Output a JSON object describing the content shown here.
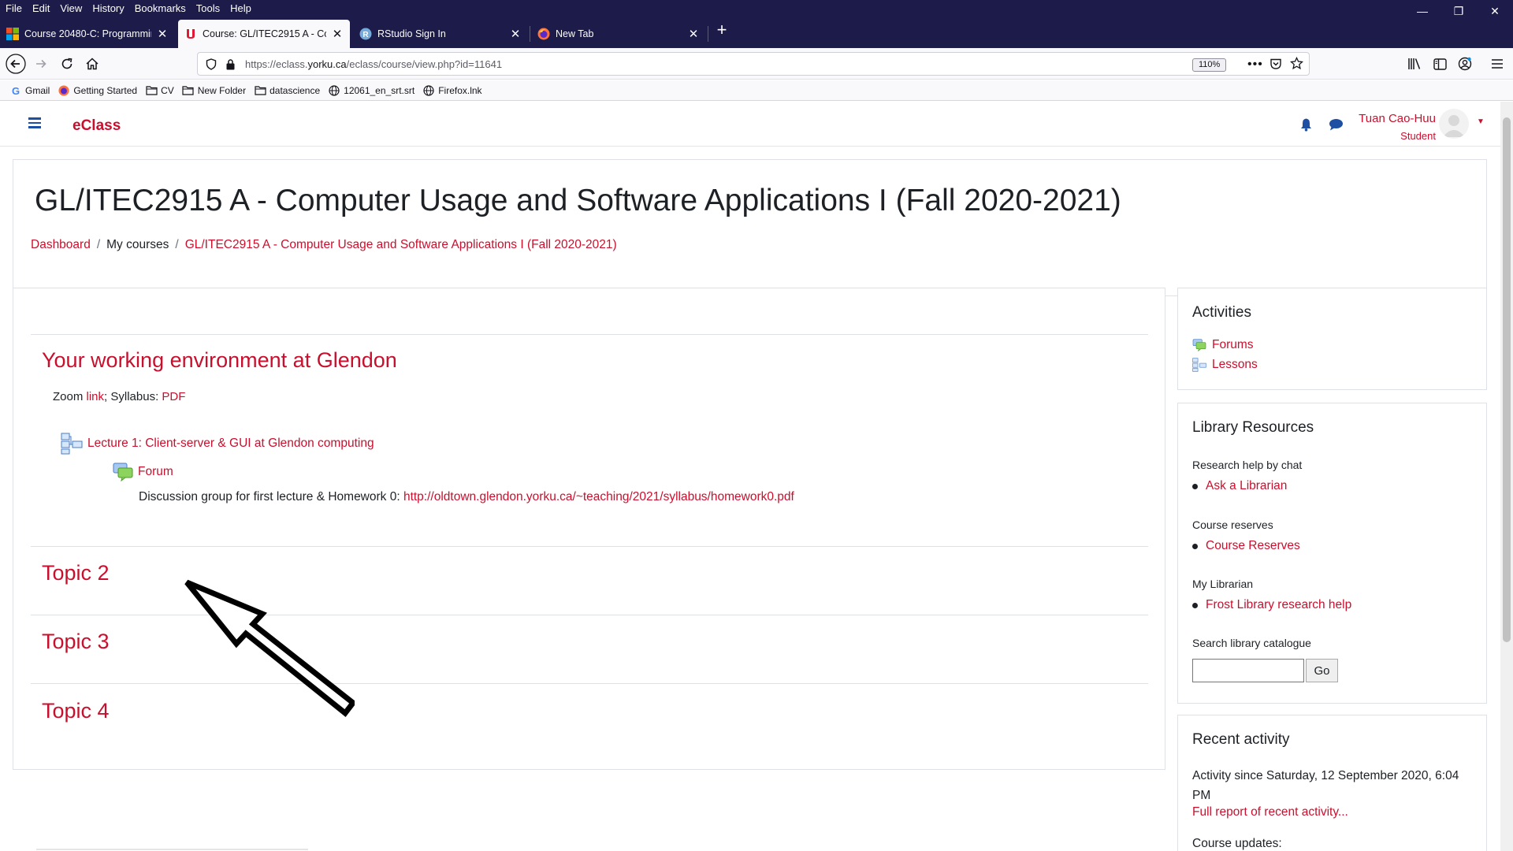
{
  "browser": {
    "menu": [
      "File",
      "Edit",
      "View",
      "History",
      "Bookmarks",
      "Tools",
      "Help"
    ],
    "tabs": [
      {
        "title": "Course 20480-C: Programming",
        "favicon": "microsoft-icon",
        "active": false
      },
      {
        "title": "Course: GL/ITEC2915 A - Comp",
        "favicon": "york-u-icon",
        "active": true
      },
      {
        "title": "RStudio Sign In",
        "favicon": "rstudio-icon",
        "active": false
      },
      {
        "title": "New Tab",
        "favicon": "firefox-icon",
        "active": false
      }
    ],
    "url_prefix": "https://eclass.",
    "url_domain": "yorku.ca",
    "url_suffix": "/eclass/course/view.php?id=11641",
    "zoom": "110%",
    "bookmarks": [
      {
        "label": "Gmail",
        "icon": "google-icon"
      },
      {
        "label": "Getting Started",
        "icon": "firefox-icon"
      },
      {
        "label": "CV",
        "icon": "folder-icon"
      },
      {
        "label": "New Folder",
        "icon": "folder-icon"
      },
      {
        "label": "datascience",
        "icon": "folder-icon"
      },
      {
        "label": "12061_en_srt.srt",
        "icon": "globe-icon"
      },
      {
        "label": "Firefox.lnk",
        "icon": "globe-icon"
      }
    ]
  },
  "site": {
    "brand": "eClass",
    "user_name": "Tuan Cao-Huu",
    "user_role": "Student"
  },
  "course": {
    "title": "GL/ITEC2915 A - Computer Usage and Software Applications I (Fall 2020-2021)",
    "breadcrumb": [
      {
        "label": "Dashboard",
        "link": true
      },
      {
        "label": "My courses",
        "link": false
      },
      {
        "label": "GL/ITEC2915 A - Computer Usage and Software Applications I (Fall 2020-2021)",
        "link": true
      }
    ],
    "section1_title": "Your working environment at Glendon",
    "summary_prefix": "Zoom ",
    "summary_zoom_link": "link",
    "summary_mid": "; Syllabus: ",
    "summary_pdf_link": "PDF",
    "lesson_label": "Lecture 1: Client-server & GUI at Glendon computing",
    "forum_label": "Forum",
    "forum_desc": "Discussion group for first lecture & Homework 0: ",
    "forum_desc_link": "http://oldtown.glendon.yorku.ca/~teaching/2021/syllabus/homework0.pdf",
    "topics": [
      "Topic 2",
      "Topic 3",
      "Topic 4"
    ]
  },
  "blocks": {
    "activities": {
      "title": "Activities",
      "items": [
        "Forums",
        "Lessons"
      ]
    },
    "library": {
      "title": "Library Resources",
      "research_label": "Research help by chat",
      "ask_link": "Ask a Librarian",
      "reserves_label": "Course reserves",
      "reserves_link": "Course Reserves",
      "librarian_label": "My Librarian",
      "librarian_link": "Frost Library research help",
      "search_label": "Search library catalogue",
      "go_button": "Go",
      "search_value": ""
    },
    "recent": {
      "title": "Recent activity",
      "since_text": "Activity since Saturday, 12 September 2020, 6:04 PM",
      "full_report_link": "Full report of recent activity...",
      "course_updates": "Course updates:"
    }
  },
  "colors": {
    "brand_red": "#c8102e",
    "browser_dark": "#1c1b4a",
    "nav_blue": "#1d4fa3"
  }
}
